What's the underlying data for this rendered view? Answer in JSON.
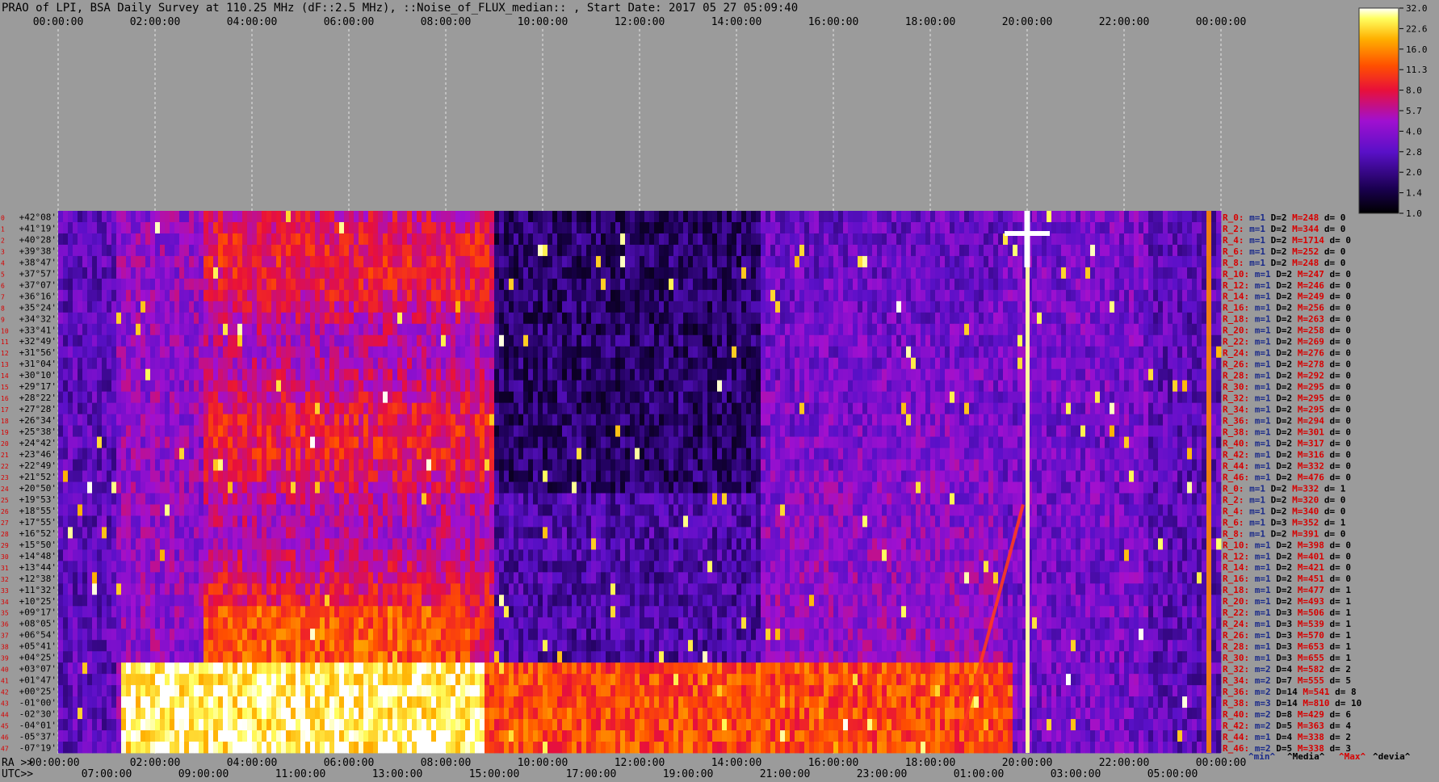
{
  "chart_data": {
    "type": "heatmap",
    "title": "PRAO of LPI, BSA Daily Survey at 110.25 MHz (dF::2.5 MHz), ::Noise_of_FLUX_median:: , Start Date: 2017 05 27 05:09:40",
    "top_axis_ticks": [
      "00:00:00",
      "02:00:00",
      "04:00:00",
      "06:00:00",
      "08:00:00",
      "10:00:00",
      "12:00:00",
      "14:00:00",
      "16:00:00",
      "18:00:00",
      "20:00:00",
      "22:00:00",
      "00:00:00"
    ],
    "ra_label": "RA >>",
    "ra_ticks": [
      "00:00:00",
      "02:00:00",
      "04:00:00",
      "06:00:00",
      "08:00:00",
      "10:00:00",
      "12:00:00",
      "14:00:00",
      "16:00:00",
      "18:00:00",
      "20:00:00",
      "22:00:00",
      "00:00:00"
    ],
    "utc_label": "UTC>>",
    "utc_ticks": [
      "07:00:00",
      "09:00:00",
      "11:00:00",
      "13:00:00",
      "15:00:00",
      "17:00:00",
      "19:00:00",
      "21:00:00",
      "23:00:00",
      "01:00:00",
      "03:00:00",
      "05:00:00"
    ],
    "declinations": [
      "+42°08'",
      "+41°19'",
      "+40°28'",
      "+39°38'",
      "+38°47'",
      "+37°57'",
      "+37°07'",
      "+36°16'",
      "+35°24'",
      "+34°32'",
      "+33°41'",
      "+32°49'",
      "+31°56'",
      "+31°04'",
      "+30°10'",
      "+29°17'",
      "+28°22'",
      "+27°28'",
      "+26°34'",
      "+25°38'",
      "+24°42'",
      "+23°46'",
      "+22°49'",
      "+21°52'",
      "+20°50'",
      "+19°53'",
      "+18°55'",
      "+17°55'",
      "+16°52'",
      "+15°50'",
      "+14°48'",
      "+13°44'",
      "+12°38'",
      "+11°32'",
      "+10°25'",
      "+09°17'",
      "+08°05'",
      "+06°54'",
      "+05°41'",
      "+04°25'",
      "+03°07'",
      "+01°47'",
      "+00°25'",
      "-01°00'",
      "-02°30'",
      "-04°01'",
      "-05°37'",
      "-07°19'"
    ],
    "beam_numbers": [
      "0",
      "1",
      "2",
      "3",
      "4",
      "5",
      "6",
      "7",
      "8",
      "9",
      "10",
      "11",
      "12",
      "13",
      "14",
      "15",
      "16",
      "17",
      "18",
      "19",
      "20",
      "21",
      "22",
      "23",
      "24",
      "25",
      "26",
      "27",
      "28",
      "29",
      "30",
      "31",
      "32",
      "33",
      "34",
      "35",
      "36",
      "37",
      "38",
      "39",
      "40",
      "41",
      "42",
      "43",
      "44",
      "45",
      "46",
      "47"
    ],
    "stats": [
      {
        "r": "R_0:",
        "m": "m=1",
        "d": "D=2",
        "mx": "M=248",
        "dv": "d= 0"
      },
      {
        "r": "R_2:",
        "m": "m=1",
        "d": "D=2",
        "mx": "M=344",
        "dv": "d= 0"
      },
      {
        "r": "R_4:",
        "m": "m=1",
        "d": "D=2",
        "mx": "M=1714",
        "dv": "d= 0"
      },
      {
        "r": "R_6:",
        "m": "m=1",
        "d": "D=2",
        "mx": "M=252",
        "dv": "d= 0"
      },
      {
        "r": "R_8:",
        "m": "m=1",
        "d": "D=2",
        "mx": "M=248",
        "dv": "d= 0"
      },
      {
        "r": "R_10:",
        "m": "m=1",
        "d": "D=2",
        "mx": "M=247",
        "dv": "d= 0"
      },
      {
        "r": "R_12:",
        "m": "m=1",
        "d": "D=2",
        "mx": "M=246",
        "dv": "d= 0"
      },
      {
        "r": "R_14:",
        "m": "m=1",
        "d": "D=2",
        "mx": "M=249",
        "dv": "d= 0"
      },
      {
        "r": "R_16:",
        "m": "m=1",
        "d": "D=2",
        "mx": "M=256",
        "dv": "d= 0"
      },
      {
        "r": "R_18:",
        "m": "m=1",
        "d": "D=2",
        "mx": "M=263",
        "dv": "d= 0"
      },
      {
        "r": "R_20:",
        "m": "m=1",
        "d": "D=2",
        "mx": "M=258",
        "dv": "d= 0"
      },
      {
        "r": "R_22:",
        "m": "m=1",
        "d": "D=2",
        "mx": "M=269",
        "dv": "d= 0"
      },
      {
        "r": "R_24:",
        "m": "m=1",
        "d": "D=2",
        "mx": "M=276",
        "dv": "d= 0"
      },
      {
        "r": "R_26:",
        "m": "m=1",
        "d": "D=2",
        "mx": "M=278",
        "dv": "d= 0"
      },
      {
        "r": "R_28:",
        "m": "m=1",
        "d": "D=2",
        "mx": "M=292",
        "dv": "d= 0"
      },
      {
        "r": "R_30:",
        "m": "m=1",
        "d": "D=2",
        "mx": "M=295",
        "dv": "d= 0"
      },
      {
        "r": "R_32:",
        "m": "m=1",
        "d": "D=2",
        "mx": "M=295",
        "dv": "d= 0"
      },
      {
        "r": "R_34:",
        "m": "m=1",
        "d": "D=2",
        "mx": "M=295",
        "dv": "d= 0"
      },
      {
        "r": "R_36:",
        "m": "m=1",
        "d": "D=2",
        "mx": "M=294",
        "dv": "d= 0"
      },
      {
        "r": "R_38:",
        "m": "m=1",
        "d": "D=2",
        "mx": "M=301",
        "dv": "d= 0"
      },
      {
        "r": "R_40:",
        "m": "m=1",
        "d": "D=2",
        "mx": "M=317",
        "dv": "d= 0"
      },
      {
        "r": "R_42:",
        "m": "m=1",
        "d": "D=2",
        "mx": "M=316",
        "dv": "d= 0"
      },
      {
        "r": "R_44:",
        "m": "m=1",
        "d": "D=2",
        "mx": "M=332",
        "dv": "d= 0"
      },
      {
        "r": "R_46:",
        "m": "m=1",
        "d": "D=2",
        "mx": "M=476",
        "dv": "d= 0"
      },
      {
        "r": "R_0:",
        "m": "m=1",
        "d": "D=2",
        "mx": "M=332",
        "dv": "d= 1"
      },
      {
        "r": "R_2:",
        "m": "m=1",
        "d": "D=2",
        "mx": "M=320",
        "dv": "d= 0"
      },
      {
        "r": "R_4:",
        "m": "m=1",
        "d": "D=2",
        "mx": "M=340",
        "dv": "d= 0"
      },
      {
        "r": "R_6:",
        "m": "m=1",
        "d": "D=3",
        "mx": "M=352",
        "dv": "d= 1"
      },
      {
        "r": "R_8:",
        "m": "m=1",
        "d": "D=2",
        "mx": "M=391",
        "dv": "d= 0"
      },
      {
        "r": "R_10:",
        "m": "m=1",
        "d": "D=2",
        "mx": "M=398",
        "dv": "d= 0"
      },
      {
        "r": "R_12:",
        "m": "m=1",
        "d": "D=2",
        "mx": "M=401",
        "dv": "d= 0"
      },
      {
        "r": "R_14:",
        "m": "m=1",
        "d": "D=2",
        "mx": "M=421",
        "dv": "d= 0"
      },
      {
        "r": "R_16:",
        "m": "m=1",
        "d": "D=2",
        "mx": "M=451",
        "dv": "d= 0"
      },
      {
        "r": "R_18:",
        "m": "m=1",
        "d": "D=2",
        "mx": "M=477",
        "dv": "d= 1"
      },
      {
        "r": "R_20:",
        "m": "m=1",
        "d": "D=2",
        "mx": "M=493",
        "dv": "d= 1"
      },
      {
        "r": "R_22:",
        "m": "m=1",
        "d": "D=3",
        "mx": "M=506",
        "dv": "d= 1"
      },
      {
        "r": "R_24:",
        "m": "m=1",
        "d": "D=3",
        "mx": "M=539",
        "dv": "d= 1"
      },
      {
        "r": "R_26:",
        "m": "m=1",
        "d": "D=3",
        "mx": "M=570",
        "dv": "d= 1"
      },
      {
        "r": "R_28:",
        "m": "m=1",
        "d": "D=3",
        "mx": "M=653",
        "dv": "d= 1"
      },
      {
        "r": "R_30:",
        "m": "m=1",
        "d": "D=3",
        "mx": "M=655",
        "dv": "d= 1"
      },
      {
        "r": "R_32:",
        "m": "m=2",
        "d": "D=4",
        "mx": "M=582",
        "dv": "d= 2"
      },
      {
        "r": "R_34:",
        "m": "m=2",
        "d": "D=7",
        "mx": "M=555",
        "dv": "d= 5"
      },
      {
        "r": "R_36:",
        "m": "m=2",
        "d": "D=14",
        "mx": "M=541",
        "dv": "d= 8"
      },
      {
        "r": "R_38:",
        "m": "m=3",
        "d": "D=14",
        "mx": "M=810",
        "dv": "d= 10"
      },
      {
        "r": "R_40:",
        "m": "m=2",
        "d": "D=8",
        "mx": "M=429",
        "dv": "d= 6"
      },
      {
        "r": "R_42:",
        "m": "m=2",
        "d": "D=5",
        "mx": "M=363",
        "dv": "d= 4"
      },
      {
        "r": "R_44:",
        "m": "m=1",
        "d": "D=4",
        "mx": "M=338",
        "dv": "d= 2"
      },
      {
        "r": "R_46:",
        "m": "m=2",
        "d": "D=5",
        "mx": "M=338",
        "dv": "d= 3"
      }
    ],
    "legend_entries": [
      "^min^",
      "^Media^",
      "^Max^",
      "^devia^"
    ],
    "colorbar_ticks": [
      "32.0",
      "22.6",
      "16.0",
      "11.3",
      "8.0",
      "5.7",
      "4.0",
      "2.8",
      "2.0",
      "1.4",
      "1.0"
    ],
    "colorbar_scale": "log",
    "grid": true,
    "features": {
      "hot_band": {
        "ra_from": "01:20:00",
        "ra_to": "08:45:00",
        "dec_from": "+03°07'",
        "dec_to": "-07°19'"
      },
      "bright_column_ra": "20:00:00",
      "lower_band_ra_from": "01:20:00",
      "lower_band_ra_to": "19:40:00"
    }
  },
  "colors": {
    "background": "#9b9b9b",
    "beam_number": "#d80000",
    "stat_r": "#d80000",
    "stat_m": "#1a2a8a",
    "stat_d": "#000000",
    "stat_max": "#d80000",
    "stat_dev": "#000000"
  }
}
